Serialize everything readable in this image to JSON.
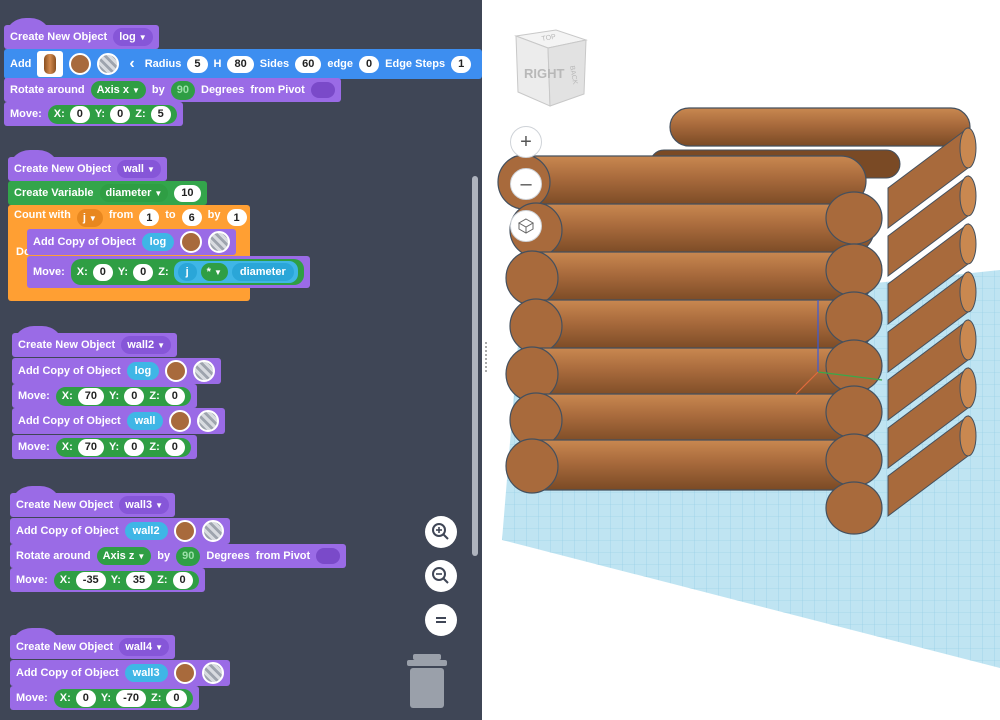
{
  "blocks": {
    "log": {
      "create_label": "Create New Object",
      "name": "log",
      "add_label": "Add",
      "radius_label": "Radius",
      "radius": "5",
      "h_label": "H",
      "h": "80",
      "sides_label": "Sides",
      "sides": "60",
      "edge_label": "edge",
      "edge": "0",
      "edge_steps_label": "Edge Steps",
      "edge_steps": "1",
      "rotate_label": "Rotate around",
      "axis": "Axis x",
      "by_label": "by",
      "degrees": "90",
      "degrees_label": "Degrees",
      "pivot_label": "from Pivot",
      "move_label": "Move:",
      "x": "0",
      "y": "0",
      "z": "5"
    },
    "wall": {
      "create_label": "Create New Object",
      "name": "wall",
      "var_label": "Create Variable",
      "var_name": "diameter",
      "var_value": "10",
      "count_label": "Count with",
      "count_var": "j",
      "from_label": "from",
      "from": "1",
      "to_label": "to",
      "to": "6",
      "by_label": "by",
      "by": "1",
      "do_label": "Do",
      "copy_label": "Add Copy of Object",
      "copy_of": "log",
      "move_label": "Move:",
      "x": "0",
      "y": "0",
      "z_var": "j",
      "z_op": "*",
      "z_var2": "diameter"
    },
    "wall2": {
      "create_label": "Create New Object",
      "name": "wall2",
      "copy1_label": "Add Copy of Object",
      "copy1_of": "log",
      "move1_label": "Move:",
      "x1": "70",
      "y1": "0",
      "z1": "0",
      "copy2_label": "Add Copy of Object",
      "copy2_of": "wall",
      "move2_label": "Move:",
      "x2": "70",
      "y2": "0",
      "z2": "0"
    },
    "wall3": {
      "create_label": "Create New Object",
      "name": "wall3",
      "copy_label": "Add Copy of Object",
      "copy_of": "wall2",
      "rotate_label": "Rotate around",
      "axis": "Axis z",
      "by_label": "by",
      "degrees": "90",
      "degrees_label": "Degrees",
      "pivot_label": "from Pivot",
      "move_label": "Move:",
      "x": "-35",
      "y": "35",
      "z": "0"
    },
    "wall4": {
      "create_label": "Create New Object",
      "name": "wall4",
      "copy_label": "Add Copy of Object",
      "copy_of": "wall3",
      "move_label": "Move:",
      "x": "0",
      "y": "-70",
      "z": "0"
    }
  },
  "labels": {
    "x": "X:",
    "y": "Y:",
    "z": "Z:"
  },
  "tools": {
    "zoom_in": "zoom-in-icon",
    "zoom_out": "zoom-out-icon",
    "reset": "equals-icon",
    "trash": "trash-icon"
  },
  "viewport": {
    "view_cube_label": "RIGHT",
    "view_cube_top": "TOP",
    "view_cube_side": "BACK",
    "colors": {
      "wood": "#a86a3c",
      "wood_light": "#c98850",
      "wood_dark": "#7a4a25",
      "grid": "#bfe4f2",
      "grid_line": "#8fcbe3"
    }
  }
}
